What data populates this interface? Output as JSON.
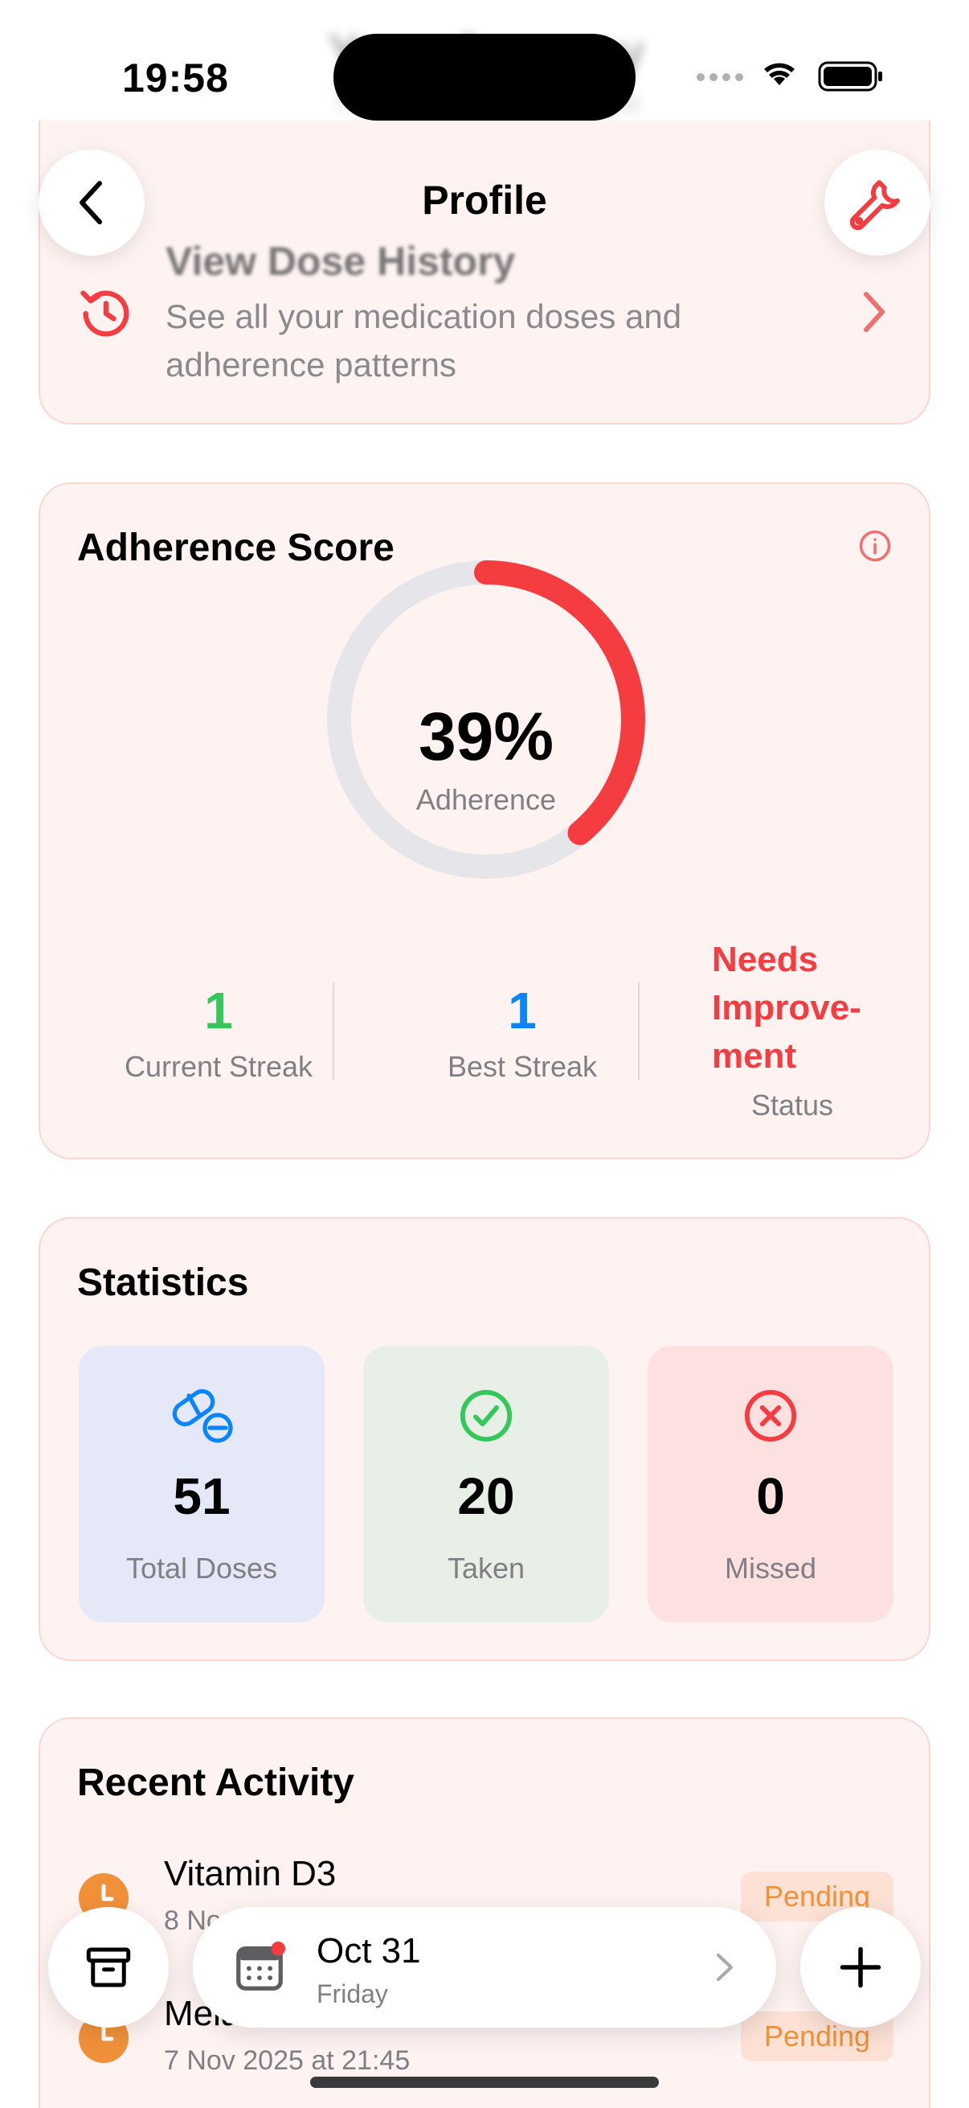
{
  "status_bar": {
    "time": "19:58"
  },
  "behind_header": {
    "title": "Your Journey",
    "subtitle": "Track your adherence"
  },
  "nav": {
    "title": "Profile"
  },
  "dose_history": {
    "title": "View Dose History",
    "description": "See all your medication doses and adherence patterns"
  },
  "adherence": {
    "title": "Adherence Score",
    "percent_value": 39,
    "percent_text": "39%",
    "percent_label": "Adherence",
    "current_streak": {
      "value": "1",
      "label": "Current Streak"
    },
    "best_streak": {
      "value": "1",
      "label": "Best Streak"
    },
    "status": {
      "line1": "Needs",
      "line2": "Improve-",
      "line3": "ment",
      "label": "Status"
    }
  },
  "statistics": {
    "title": "Statistics",
    "tiles": [
      {
        "value": "51",
        "label": "Total Doses",
        "icon": "pill-icon"
      },
      {
        "value": "20",
        "label": "Taken",
        "icon": "check-circle-icon"
      },
      {
        "value": "0",
        "label": "Missed",
        "icon": "x-circle-icon"
      }
    ]
  },
  "recent_activity": {
    "title": "Recent Activity",
    "items": [
      {
        "name": "Vitamin D3",
        "time": "8 No",
        "status": "Pending"
      },
      {
        "name": "Melaton",
        "time": "7 Nov 2025 at 21:45",
        "status": "Pending"
      }
    ]
  },
  "bottom_bar": {
    "date": "Oct 31",
    "weekday": "Friday"
  },
  "colors": {
    "accent_red": "#f53c41",
    "streak_green": "#34c759",
    "streak_blue": "#0a84ff",
    "pending_orange": "#f0913a",
    "card_bg": "#fff3f2"
  }
}
